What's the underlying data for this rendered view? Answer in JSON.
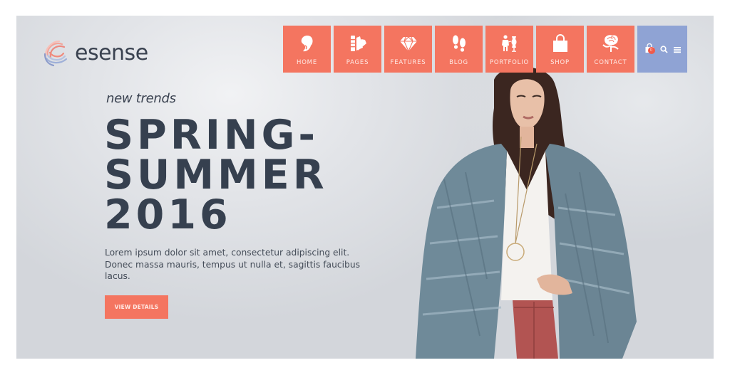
{
  "brand": {
    "name": "esense",
    "logo_icon": "swirl-logo-icon"
  },
  "nav": {
    "items": [
      {
        "label": "HOME",
        "icon": "head-silhouette-icon"
      },
      {
        "label": "PAGES",
        "icon": "swatch-fan-icon"
      },
      {
        "label": "FEATURES",
        "icon": "diamond-icon"
      },
      {
        "label": "BLOG",
        "icon": "footprints-icon"
      },
      {
        "label": "PORTFOLIO",
        "icon": "tailor-mannequin-icon"
      },
      {
        "label": "SHOP",
        "icon": "shopping-bag-icon"
      },
      {
        "label": "CONTACT",
        "icon": "rose-icon"
      }
    ],
    "tools": {
      "cart_icon": "cart-bag-icon",
      "cart_count": "0",
      "search_icon": "search-icon",
      "menu_icon": "hamburger-menu-icon"
    }
  },
  "hero": {
    "kicker": "new trends",
    "headline_lines": [
      "SPRING-",
      "SUMMER",
      "2016"
    ],
    "description": "Lorem ipsum dolor sit amet, consectetur adipiscing elit. Donec massa mauris, tempus ut nulla et, sagittis faucibus lacus.",
    "cta_label": "VIEW DETAILS",
    "image": "fashion-model-photo"
  },
  "colors": {
    "accent": "#f47560",
    "tools_bg": "#8fa3d4",
    "headline": "#36404f",
    "badge": "#f05a4a"
  }
}
